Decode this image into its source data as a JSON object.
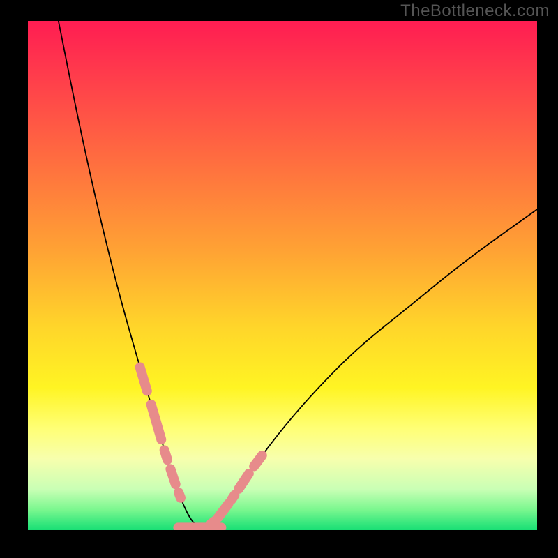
{
  "attribution": "TheBottleneck.com",
  "chart_data": {
    "type": "line",
    "title": "",
    "xlabel": "",
    "ylabel": "",
    "xlim": [
      0,
      100
    ],
    "ylim": [
      0,
      100
    ],
    "series": [
      {
        "name": "bottleneck-curve",
        "x": [
          6,
          10,
          14,
          18,
          22,
          25,
          27,
          29,
          30.5,
          32,
          33.5,
          35,
          37,
          40,
          44,
          50,
          57,
          65,
          75,
          86,
          100
        ],
        "y": [
          100,
          80,
          62,
          46,
          32,
          22,
          15,
          9,
          5,
          2,
          0.5,
          0.6,
          2,
          6,
          12,
          20,
          28,
          36,
          44,
          53,
          63
        ]
      }
    ],
    "overlay_markers": {
      "name": "highlight-dots",
      "color": "#e78b8b",
      "left_cluster_x_range": [
        22,
        30
      ],
      "right_cluster_x_range": [
        36,
        46
      ],
      "valley_line_x_range": [
        29.5,
        38
      ],
      "valley_y": 0.5
    },
    "background_gradient_stops": [
      {
        "pos": 0,
        "color": "#ff1d52"
      },
      {
        "pos": 0.28,
        "color": "#ff6f3f"
      },
      {
        "pos": 0.6,
        "color": "#ffd52a"
      },
      {
        "pos": 0.8,
        "color": "#ffff75"
      },
      {
        "pos": 0.96,
        "color": "#7af78f"
      },
      {
        "pos": 1.0,
        "color": "#1adf75"
      }
    ]
  }
}
